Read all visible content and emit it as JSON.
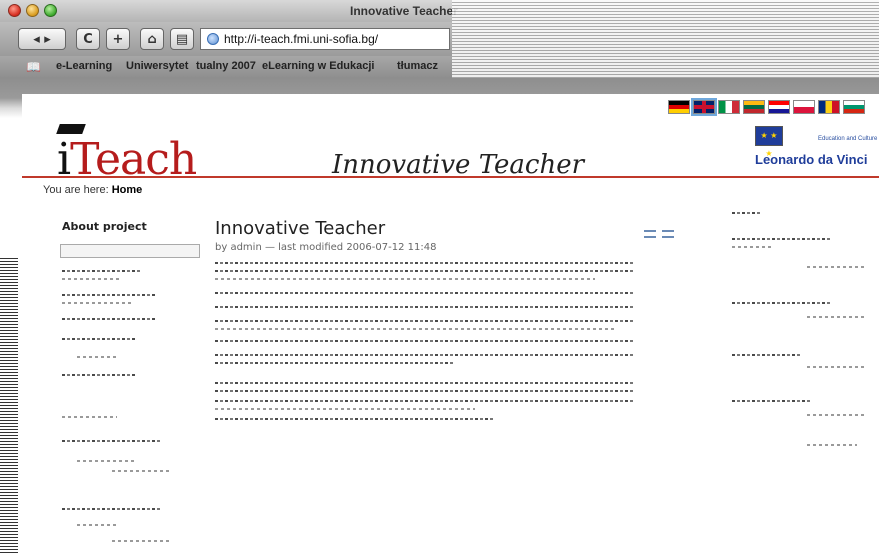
{
  "window": {
    "title": "Innovative Teacher"
  },
  "toolbar": {
    "back_label": "◂ ▸",
    "reload_label": "C",
    "add_label": "+",
    "home_label": "⌂",
    "print_label": "▤",
    "url": "http://i-teach.fmi.uni-sofia.bg/"
  },
  "bookmarks": {
    "items": [
      {
        "label": "e-Learning"
      },
      {
        "label": "Uniwersytet"
      },
      {
        "label": "tualny 2007"
      },
      {
        "label": "eLearning w Edukacji"
      },
      {
        "label": "tłumacz"
      }
    ]
  },
  "header": {
    "logo_i": "i",
    "logo_rest": "Teach",
    "site_title": "Innovative Teacher",
    "edu_text": "Education and Culture",
    "leonardo": "Leonardo da Vinci",
    "flags": [
      {
        "name": "german-flag",
        "colors": [
          "#000000",
          "#dd0000",
          "#ffce00"
        ]
      },
      {
        "name": "uk-flag",
        "colors": [
          "#012169",
          "#ffffff",
          "#c8102e"
        ]
      },
      {
        "name": "italian-flag",
        "colors": [
          "#009246",
          "#ffffff",
          "#ce2b37"
        ]
      },
      {
        "name": "lithuanian-flag",
        "colors": [
          "#fdb913",
          "#006a44",
          "#c1272d"
        ]
      },
      {
        "name": "croatian-flag",
        "colors": [
          "#ff0000",
          "#ffffff",
          "#171796"
        ]
      },
      {
        "name": "polish-flag",
        "colors": [
          "#ffffff",
          "#dc143c"
        ]
      },
      {
        "name": "romanian-flag",
        "colors": [
          "#002b7f",
          "#fcd116",
          "#ce1126"
        ]
      },
      {
        "name": "bulgarian-flag",
        "colors": [
          "#ffffff",
          "#00966e",
          "#d62612"
        ]
      }
    ]
  },
  "breadcrumb": {
    "prefix": "You are here:",
    "current": "Home"
  },
  "sidebar": {
    "title": "About project"
  },
  "main": {
    "heading": "Innovative Teacher",
    "byline": "by admin — last modified 2006-07-12 11:48"
  },
  "colors": {
    "brand_red": "#b51c1c",
    "rule_red": "#c0392b",
    "leonardo_blue": "#1f3d9a"
  }
}
